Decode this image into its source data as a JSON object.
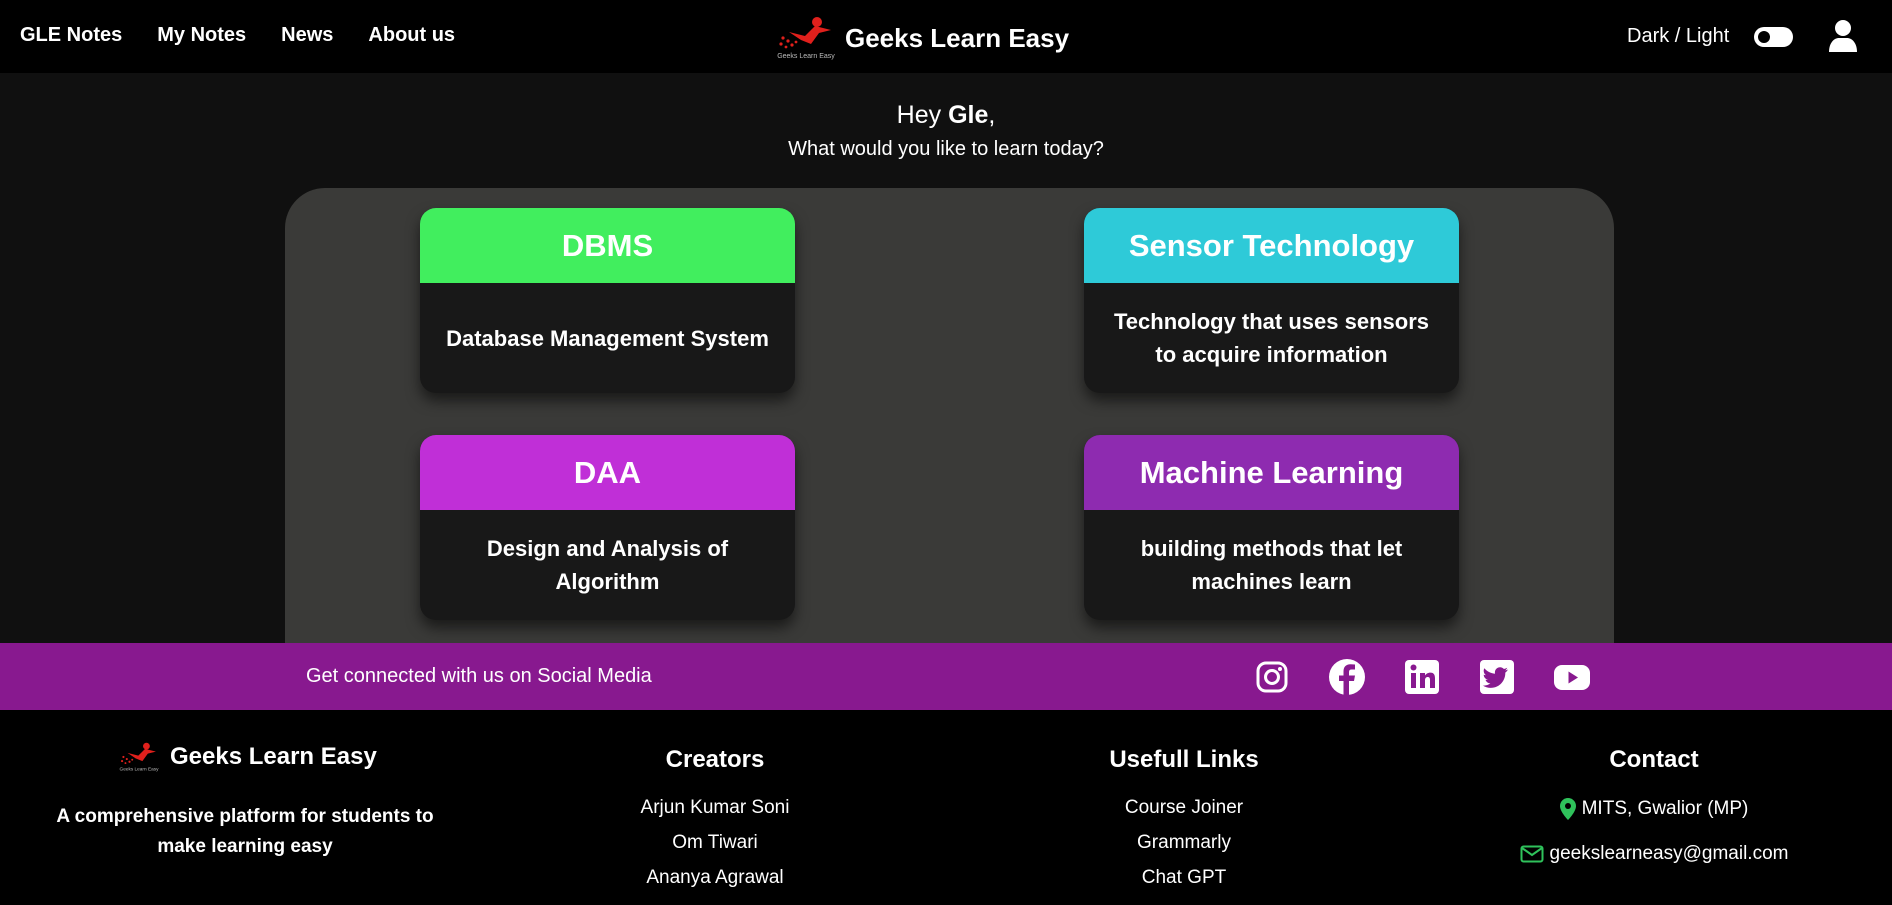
{
  "nav": {
    "links": [
      "GLE Notes",
      "My Notes",
      "News",
      "About us"
    ],
    "brand": "Geeks Learn Easy",
    "logo_text": "Geeks Learn Easy",
    "theme_label": "Dark / Light"
  },
  "greeting": {
    "prefix": "Hey ",
    "name": "Gle",
    "suffix": ",",
    "subtitle": "What would you like to learn today?"
  },
  "cards": [
    {
      "title": "DBMS",
      "description": "Database Management System",
      "color": "#41ee5e"
    },
    {
      "title": "Sensor Technology",
      "description": "Technology that uses sensors to acquire information",
      "color": "#2ecad8"
    },
    {
      "title": "DAA",
      "description": "Design and Analysis of Algorithm",
      "color": "#c02fd7"
    },
    {
      "title": "Machine Learning",
      "description": "building methods that let machines learn",
      "color": "#8e2bb0"
    }
  ],
  "social": {
    "text": "Get connected with us on Social Media",
    "icons": [
      "instagram-icon",
      "facebook-icon",
      "linkedin-icon",
      "twitter-icon",
      "youtube-icon"
    ],
    "bar_color": "#88198f"
  },
  "footer": {
    "brand": "Geeks Learn Easy",
    "description": "A comprehensive platform for students to make learning easy",
    "creators": {
      "heading": "Creators",
      "items": [
        "Arjun Kumar Soni",
        "Om Tiwari",
        "Ananya Agrawal"
      ]
    },
    "links": {
      "heading": "Usefull Links",
      "items": [
        "Course Joiner",
        "Grammarly",
        "Chat GPT"
      ]
    },
    "contact": {
      "heading": "Contact",
      "location": "MITS, Gwalior (MP)",
      "email": "geekslearneasy@gmail.com",
      "icon_color": "#2fc25b"
    }
  }
}
